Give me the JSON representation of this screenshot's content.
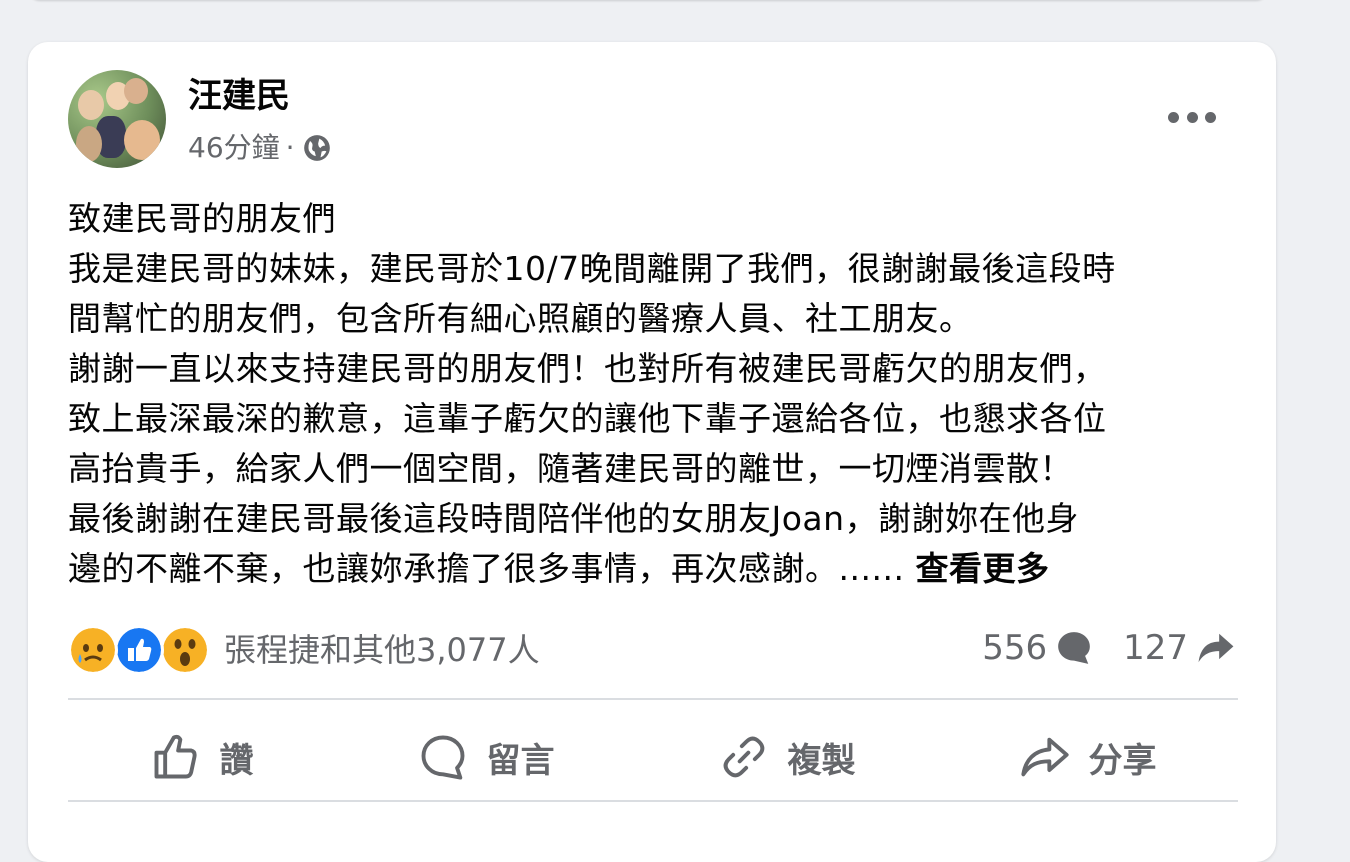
{
  "post": {
    "author": "汪建民",
    "timestamp": "46分鐘",
    "separator": "·",
    "audience_icon": "globe-icon",
    "body_lines": [
      "致建民哥的朋友們",
      "我是建民哥的妹妹，建民哥於10/7晚間離開了我們，很謝謝最後這段時",
      "間幫忙的朋友們，包含所有細心照顧的醫療人員、社工朋友。",
      "謝謝一直以來支持建民哥的朋友們！也對所有被建民哥虧欠的朋友們，",
      "致上最深最深的歉意，這輩子虧欠的讓他下輩子還給各位，也懇求各位",
      "高抬貴手，給家人們一個空間，隨著建民哥的離世，一切煙消雲散！",
      "最後謝謝在建民哥最後這段時間陪伴他的女朋友Joan，謝謝妳在他身",
      "邊的不離不棄，也讓妳承擔了很多事情，再次感謝。......"
    ],
    "see_more": "查看更多"
  },
  "reactions": {
    "icons": [
      "sad-reaction-icon",
      "like-reaction-icon",
      "wow-reaction-icon"
    ],
    "summary": "張程捷和其他3,077人",
    "comments_count": "556",
    "shares_count": "127"
  },
  "actions": {
    "like": "讚",
    "comment": "留言",
    "copy": "複製",
    "share": "分享"
  },
  "colors": {
    "secondary_text": "#65676b",
    "like_blue": "#1877f2",
    "reaction_yellow": "#f7b125",
    "divider": "#dadde1"
  }
}
